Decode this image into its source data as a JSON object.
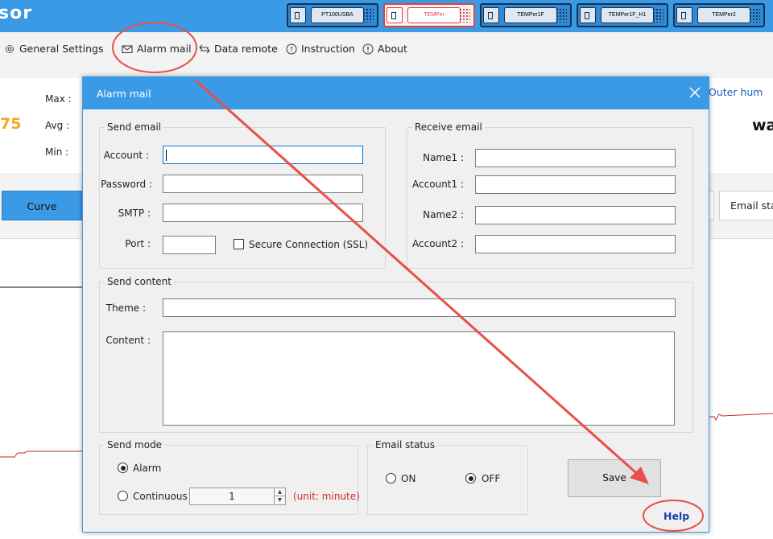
{
  "app": {
    "brand_fragment": "sor",
    "devices": [
      {
        "label": "PT100USBA",
        "selected": false
      },
      {
        "label": "TEMPer",
        "selected": true
      },
      {
        "label": "TEMPer1F",
        "selected": false
      },
      {
        "label": "TEMPer1F_H1",
        "selected": false
      },
      {
        "label": "TEMPer2",
        "selected": false
      }
    ],
    "menu": [
      {
        "label": "General Settings",
        "icon": "gear-icon"
      },
      {
        "label": "Alarm mail",
        "icon": "envelope-icon"
      },
      {
        "label": "Data remote",
        "icon": "transfer-arrows-icon"
      },
      {
        "label": "Instruction",
        "icon": "question-circle-icon"
      },
      {
        "label": "About",
        "icon": "info-circle-icon"
      }
    ],
    "stats": {
      "max_label": "Max :",
      "avg_label": "Avg :",
      "min_label": "Min :",
      "big_value": "75",
      "outer_hum": "Outer hum",
      "right_value": "wa"
    },
    "tabs": {
      "curve": "Curve",
      "email_status": "Email sta"
    }
  },
  "dialog": {
    "title": "Alarm mail",
    "send_email": {
      "title": "Send email",
      "account_label": "Account :",
      "account_value": "",
      "password_label": "Password :",
      "password_value": "",
      "smtp_label": "SMTP :",
      "smtp_value": "",
      "port_label": "Port :",
      "port_value": "",
      "ssl_label": "Secure Connection (SSL)"
    },
    "receive_email": {
      "title": "Receive email",
      "name1_label": "Name1 :",
      "name1_value": "",
      "account1_label": "Account1 :",
      "account1_value": "",
      "name2_label": "Name2 :",
      "name2_value": "",
      "account2_label": "Account2 :",
      "account2_value": ""
    },
    "send_content": {
      "title": "Send content",
      "theme_label": "Theme :",
      "theme_value": "",
      "content_label": "Content :"
    },
    "send_mode": {
      "title": "Send mode",
      "alarm_label": "Alarm",
      "continuous_label": "Continuous",
      "interval_value": "1",
      "unit_label": "(unit: minute)",
      "selected": "alarm"
    },
    "email_status": {
      "title": "Email status",
      "on_label": "ON",
      "off_label": "OFF",
      "selected": "off"
    },
    "save_label": "Save",
    "help_label": "Help"
  },
  "colors": {
    "accent": "#3b9ae6",
    "annotation": "#e8504a",
    "unit_text": "#d12b2b",
    "help_link": "#1a3fb0"
  }
}
